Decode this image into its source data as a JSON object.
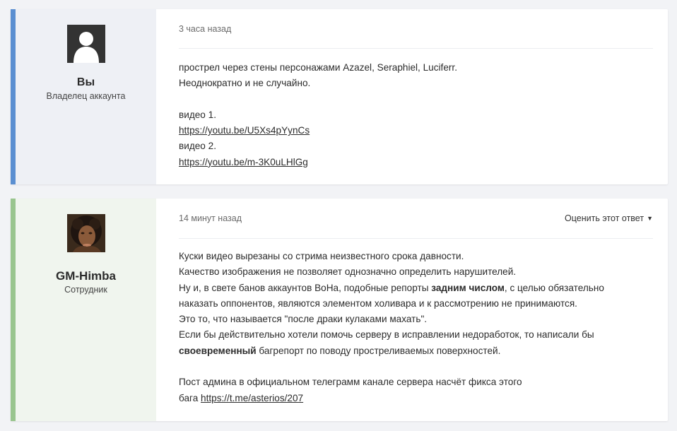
{
  "colors": {
    "post1_accent": "#5b8fd1",
    "post1_author_bg": "#eef0f5",
    "post2_accent": "#99c58e",
    "post2_author_bg": "#f0f5ee"
  },
  "posts": [
    {
      "author": {
        "name": "Вы",
        "role": "Владелец аккаунта",
        "avatar": "default-avatar-icon"
      },
      "time": "3 часа назад",
      "lines": {
        "l1": "прострел через стены персонажами Azazel, Seraphiel, Luciferr.",
        "l2": "Неоднократно и не случайно.",
        "l3": "видео 1.",
        "link1": "https://youtu.be/U5Xs4pYynCs",
        "l4": "видео 2.",
        "link2": "https://youtu.be/m-3K0uLHlGg"
      }
    },
    {
      "author": {
        "name": "GM-Himba",
        "role": "Сотрудник",
        "avatar": "user-photo-avatar"
      },
      "time": "14 минут назад",
      "rate_label": "Оценить этот ответ",
      "lines": {
        "l1": "Куски видео вырезаны со стрима неизвестного срока давности.",
        "l2": "Качество изображения не позволяет однозначно определить нарушителей.",
        "l3a": "Ну и, в свете банов аккаунтов BoHa, подобные репорты ",
        "l3b": "задним числом",
        "l3c": ", с целью обязательно",
        "l4": "наказать оппонентов, являются элементом холивара и к рассмотрению не принимаются.",
        "l5": "Это то, что называется \"после драки кулаками махать\".",
        "l6": "Если бы действительно хотели помочь серверу в исправлении недоработок, то написали бы",
        "l7a": "своевременный",
        "l7b": " багрепорт по поводу простреливаемых поверхностей.",
        "l8": "Пост админа в официальном телеграмм канале сервера насчёт фикса этого",
        "l9a": "бага ",
        "link1": "https://t.me/asterios/207"
      }
    }
  ]
}
